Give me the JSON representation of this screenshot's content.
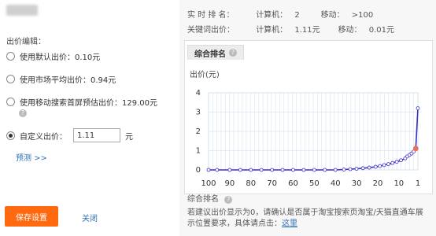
{
  "left": {
    "section_label": "出价编辑：",
    "options": [
      {
        "label": "使用默认出价：0.10元",
        "selected": false
      },
      {
        "label": "使用市场平均出价：0.94元",
        "selected": false
      },
      {
        "label": "使用移动搜索首屏预估出价：129.00元",
        "selected": false
      },
      {
        "label": "自定义出价：",
        "selected": true
      }
    ],
    "custom_bid_value": "1.11",
    "unit": "元",
    "preview_label": "预测  >>",
    "save_label": "保存设置",
    "close_label": "关闭"
  },
  "right": {
    "row1": {
      "label": "实 时 排 名：",
      "pc_label": "计算机：",
      "pc_value": "2",
      "mobile_label": "移动：",
      "mobile_value": ">100"
    },
    "row2": {
      "label": "关键词出价：",
      "pc_label": "计算机：",
      "pc_value": "1.11元",
      "mobile_label": "移动：",
      "mobile_value": "0.01元"
    },
    "tab_label": "综合排名",
    "chart_caption": "综合排名",
    "note_text": "若建议出价显示为0，请确认是否属于淘宝搜索页淘宝/天猫直通车展示位置要求，具体请点击：",
    "note_link": "这里"
  },
  "colors": {
    "accent": "#ff6a10",
    "link": "#2f6fb5",
    "line": "#3b2fc9",
    "point_fill": "#ffffff",
    "point_highlight": "#e8735a"
  },
  "chart_data": {
    "type": "line",
    "ylabel": "出价(元)",
    "xlabel": "",
    "x_ticks": [
      100,
      90,
      80,
      70,
      60,
      50,
      40,
      30,
      20,
      10,
      1
    ],
    "y_ticks": [
      0,
      1,
      2,
      3,
      4
    ],
    "xlim": [
      100,
      1
    ],
    "ylim": [
      0,
      4
    ],
    "grid": true,
    "series": [
      {
        "x": [
          100,
          96,
          90,
          85,
          80,
          75,
          70,
          65,
          60,
          55,
          50,
          45,
          40,
          36,
          33,
          30,
          27,
          24,
          21,
          19,
          17,
          15,
          13,
          11,
          9,
          7,
          6,
          5,
          4,
          3,
          2,
          1
        ],
        "y": [
          0,
          0,
          0,
          0,
          0,
          0,
          0,
          0,
          0,
          0,
          0,
          0,
          0,
          0.02,
          0.04,
          0.06,
          0.09,
          0.12,
          0.16,
          0.2,
          0.25,
          0.3,
          0.36,
          0.42,
          0.5,
          0.6,
          0.7,
          0.78,
          0.85,
          0.95,
          1.11,
          3.2
        ]
      }
    ],
    "highlight_x": 2
  }
}
